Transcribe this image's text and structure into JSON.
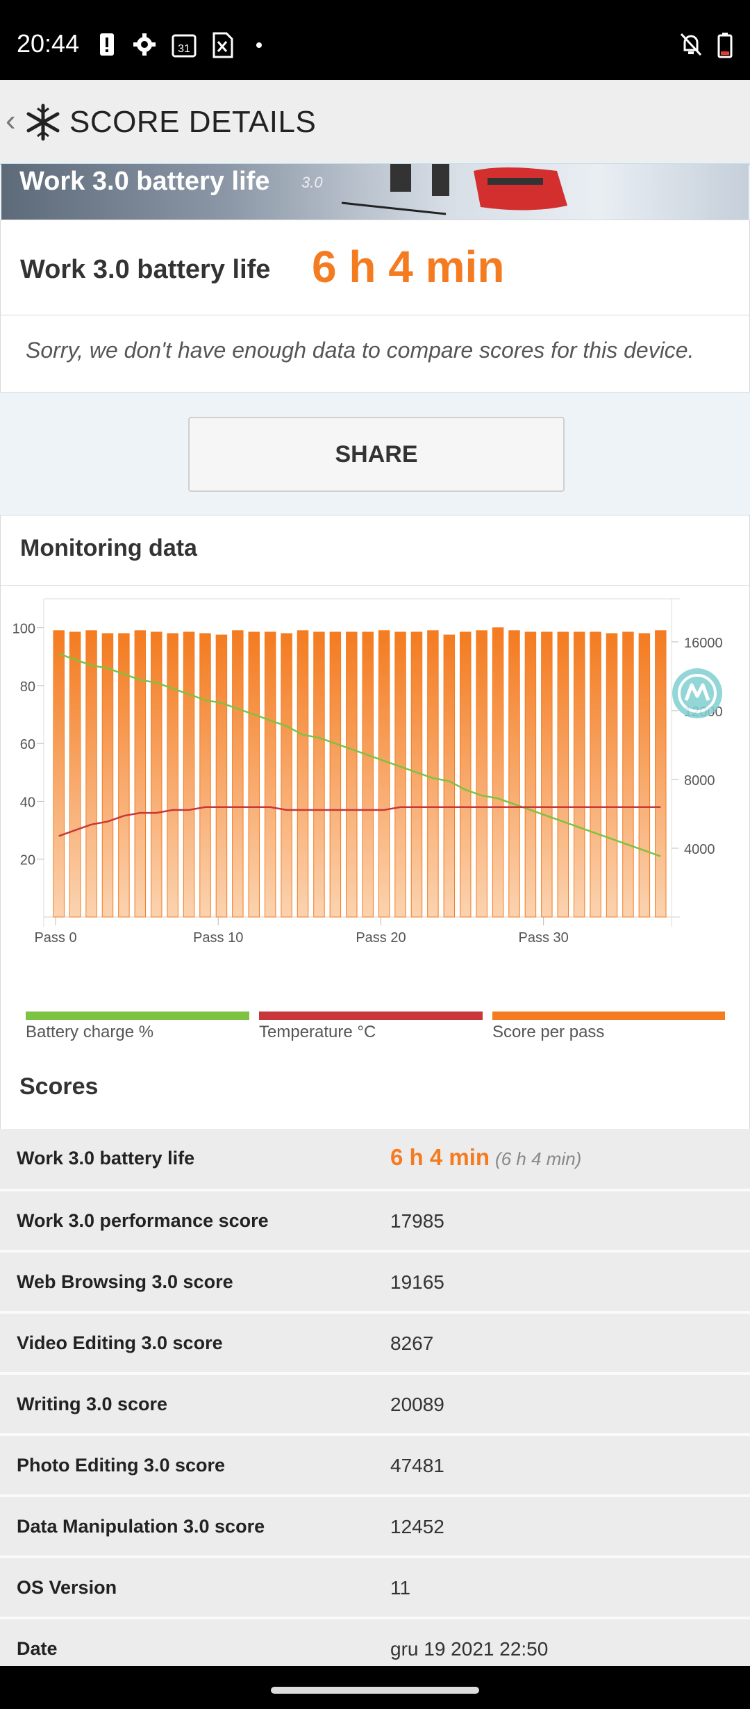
{
  "status": {
    "time": "20:44",
    "calendar_day": "31"
  },
  "appbar": {
    "title": "SCORE DETAILS"
  },
  "banner": {
    "title": "Work 3.0 battery life",
    "version": "3.0"
  },
  "result": {
    "label": "Work 3.0 battery life",
    "value": "6 h 4 min"
  },
  "notice": "Sorry, we don't have enough data to compare scores for this device.",
  "share_label": "SHARE",
  "monitoring": {
    "title": "Monitoring data",
    "legend": [
      {
        "label": "Battery charge %",
        "color": "#7dc242"
      },
      {
        "label": "Temperature °C",
        "color": "#c8373a"
      },
      {
        "label": "Score per pass",
        "color": "#f47b20"
      }
    ]
  },
  "chart_data": {
    "type": "bar",
    "x_ticks": [
      "Pass 0",
      "Pass 10",
      "Pass 20",
      "Pass 30"
    ],
    "y_left_ticks": [
      "100",
      "80",
      "60",
      "40",
      "20"
    ],
    "y_right_ticks": [
      "16000",
      "12000",
      "8000",
      "4000"
    ],
    "ylim_left": [
      0,
      110
    ],
    "ylim_right": [
      0,
      18500
    ],
    "series": [
      {
        "name": "Score per pass",
        "axis": "left",
        "values": [
          99,
          98.5,
          99,
          98,
          98,
          99,
          98.5,
          98,
          98.5,
          98,
          97.5,
          99,
          98.5,
          98.5,
          98,
          99,
          98.5,
          98.5,
          98.5,
          98.5,
          99,
          98.5,
          98.5,
          99,
          97.5,
          98.5,
          99,
          100,
          99,
          98.5,
          98.5,
          98.5,
          98.5,
          98.5,
          98,
          98.5,
          98,
          99
        ]
      },
      {
        "name": "Battery charge %",
        "axis": "left",
        "values": [
          91,
          89,
          87,
          86,
          84,
          82,
          81,
          79,
          77,
          75,
          74,
          72,
          70,
          68,
          66,
          63,
          62,
          60,
          58,
          56,
          54,
          52,
          50,
          48,
          47,
          44,
          42,
          41,
          39,
          37,
          35,
          33,
          31,
          29,
          27,
          25,
          23,
          21
        ]
      },
      {
        "name": "Temperature °C",
        "axis": "left",
        "values": [
          28,
          30,
          32,
          33,
          35,
          36,
          36,
          37,
          37,
          38,
          38,
          38,
          38,
          38,
          37,
          37,
          37,
          37,
          37,
          37,
          37,
          38,
          38,
          38,
          38,
          38,
          38,
          38,
          38,
          38,
          38,
          38,
          38,
          38,
          38,
          38,
          38,
          38
        ]
      }
    ]
  },
  "scores": {
    "title": "Scores",
    "rows": [
      {
        "label": "Work 3.0 battery life",
        "value": "6 h 4 min",
        "sub": "(6 h 4 min)"
      },
      {
        "label": "Work 3.0 performance score",
        "value": "17985"
      },
      {
        "label": "Web Browsing 3.0 score",
        "value": "19165"
      },
      {
        "label": "Video Editing 3.0 score",
        "value": "8267"
      },
      {
        "label": "Writing 3.0 score",
        "value": "20089"
      },
      {
        "label": "Photo Editing 3.0 score",
        "value": "47481"
      },
      {
        "label": "Data Manipulation 3.0 score",
        "value": "12452"
      },
      {
        "label": "OS Version",
        "value": "11"
      },
      {
        "label": "Date",
        "value": "gru 19 2021 22:50"
      }
    ]
  }
}
